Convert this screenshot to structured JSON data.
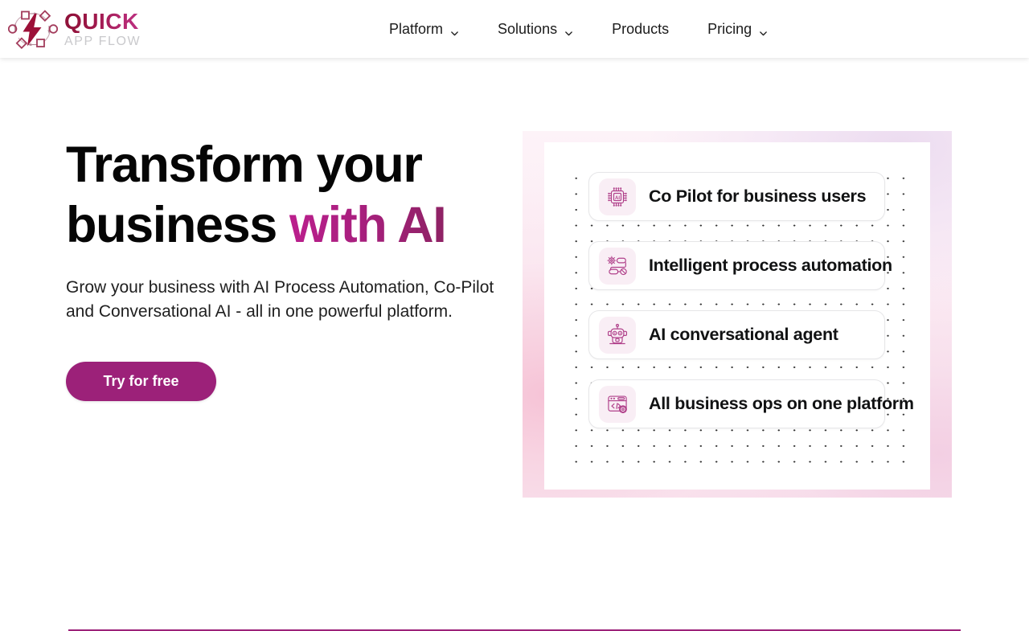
{
  "brand": {
    "name_top": "QUICK",
    "name_bottom": "APP FLOW",
    "logo_icon": "lightning-flow-logo-icon"
  },
  "nav": {
    "items": [
      {
        "label": "Platform",
        "has_dropdown": true,
        "icon": "chevron-down-icon"
      },
      {
        "label": "Solutions",
        "has_dropdown": true,
        "icon": "chevron-down-icon"
      },
      {
        "label": "Products",
        "has_dropdown": false,
        "icon": ""
      },
      {
        "label": "Pricing",
        "has_dropdown": true,
        "icon": "chevron-down-icon"
      }
    ]
  },
  "hero": {
    "headline_line1": "Transform your",
    "headline_line2_plain": "business ",
    "headline_line2_accent": "with AI",
    "subhead": "Grow your business with AI Process Automation, Co-Pilot and Conversational AI - all in one powerful platform.",
    "cta_label": "Try for free"
  },
  "hero_visual": {
    "cards": [
      {
        "label": "Co Pilot for business users",
        "icon": "ai-chip-icon"
      },
      {
        "label": "Intelligent process automation",
        "icon": "process-workflow-icon"
      },
      {
        "label": "AI conversational agent",
        "icon": "robot-icon"
      },
      {
        "label": "All business ops on one platform",
        "icon": "browser-code-gear-icon"
      }
    ]
  },
  "colors": {
    "brand_magenta": "#9c2179",
    "brand_wine": "#8e1138",
    "accent_gradient_start": "#bb1f8d",
    "accent_gradient_end": "#8e2264",
    "headline_text": "#050505",
    "nav_text": "#1b1b1b",
    "logo_sub_text": "#c9c9cc",
    "icon_tile_bg": "#f9eef5",
    "card_border": "#e6e6e8",
    "page_bg": "#ffffff"
  }
}
